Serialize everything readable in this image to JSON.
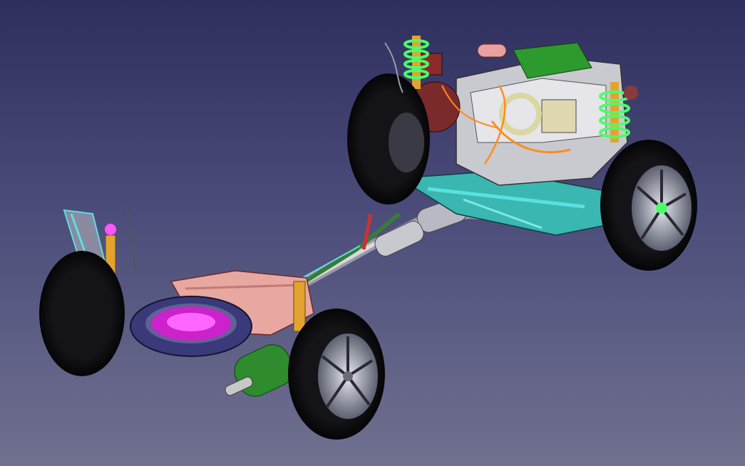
{
  "view": {
    "background_top": "#2f2f5f",
    "background_bottom": "#70718f"
  },
  "model": {
    "colors": {
      "tire": "#0b0b0d",
      "rim": "#b8bccb",
      "spring": "#4cff6a",
      "subframe": "#5be0e0",
      "engine": "#d9d9de",
      "fuel_tank": "#e8a7a0",
      "muffler": "#2e8b2e",
      "exhaust": "#c8c8c8",
      "shock": "#e2a330",
      "spare_well": "#ff33ff",
      "intake": "#2c9a2c",
      "brake_disc": "#8a2a2a",
      "accent_cable": "#ff8c1a"
    }
  }
}
